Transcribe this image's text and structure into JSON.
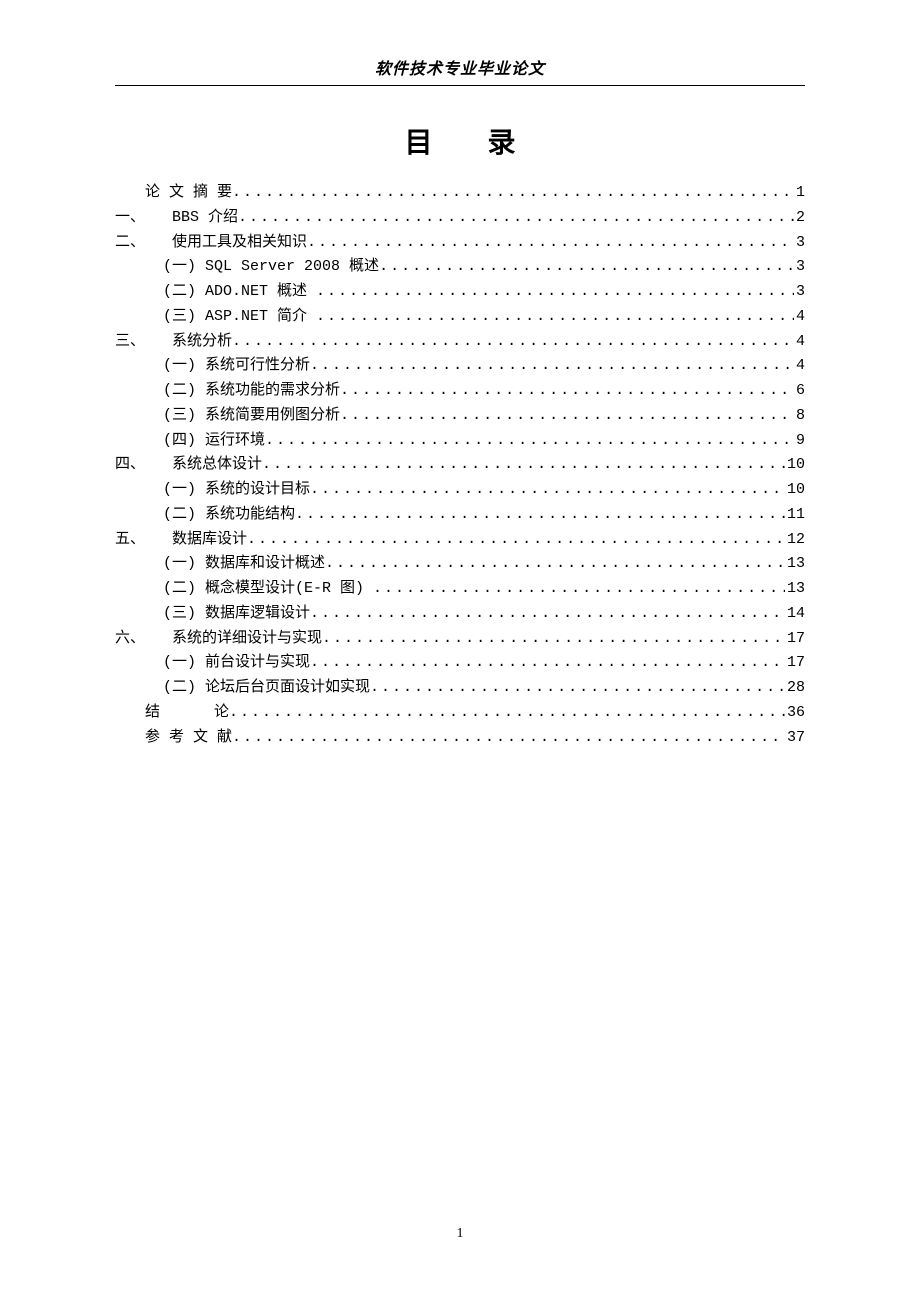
{
  "header": {
    "title": "软件技术专业毕业论文"
  },
  "toc": {
    "title": "目录",
    "entries": [
      {
        "level": "top",
        "label": "论 文 摘 要",
        "page": "1"
      },
      {
        "level": "chapter",
        "num": "一、",
        "label": "BBS 介绍",
        "page": "2"
      },
      {
        "level": "chapter",
        "num": "二、",
        "label": "使用工具及相关知识",
        "page": "3"
      },
      {
        "level": "sub",
        "num": "(一)",
        "label": "SQL Server 2008 概述",
        "page": "3"
      },
      {
        "level": "sub",
        "num": "(二)",
        "label": "ADO.NET 概述 ",
        "page": "3"
      },
      {
        "level": "sub",
        "num": "(三)",
        "label": "ASP.NET 简介 ",
        "page": "4"
      },
      {
        "level": "chapter",
        "num": "三、",
        "label": "系统分析",
        "page": "4"
      },
      {
        "level": "sub",
        "num": "(一)",
        "label": "系统可行性分析",
        "page": "4"
      },
      {
        "level": "sub",
        "num": "(二)",
        "label": "系统功能的需求分析",
        "page": "6"
      },
      {
        "level": "sub",
        "num": "(三)",
        "label": "系统简要用例图分析",
        "page": "8"
      },
      {
        "level": "sub",
        "num": "(四)",
        "label": "运行环境",
        "page": "9"
      },
      {
        "level": "chapter",
        "num": "四、",
        "label": "系统总体设计",
        "page": "10"
      },
      {
        "level": "sub",
        "num": "(一)",
        "label": "系统的设计目标",
        "page": "10"
      },
      {
        "level": "sub",
        "num": "(二)",
        "label": "系统功能结构",
        "page": "11"
      },
      {
        "level": "chapter",
        "num": "五、",
        "label": "数据库设计",
        "page": "12"
      },
      {
        "level": "sub",
        "num": "(一)",
        "label": "数据库和设计概述",
        "page": "13"
      },
      {
        "level": "sub",
        "num": "(二)",
        "label": "概念模型设计(E-R 图) ",
        "page": "13"
      },
      {
        "level": "sub",
        "num": "(三)",
        "label": "数据库逻辑设计",
        "page": "14"
      },
      {
        "level": "chapter",
        "num": "六、",
        "label": "系统的详细设计与实现",
        "page": "17"
      },
      {
        "level": "sub",
        "num": "(一)",
        "label": "前台设计与实现",
        "page": "17"
      },
      {
        "level": "sub",
        "num": "(二)",
        "label": "论坛后台页面设计如实现",
        "page": "28"
      },
      {
        "level": "top",
        "label": "结      论",
        "page": "36"
      },
      {
        "level": "top",
        "label": "参 考 文 献",
        "page": "37"
      }
    ]
  },
  "footer": {
    "pageNumber": "1"
  }
}
